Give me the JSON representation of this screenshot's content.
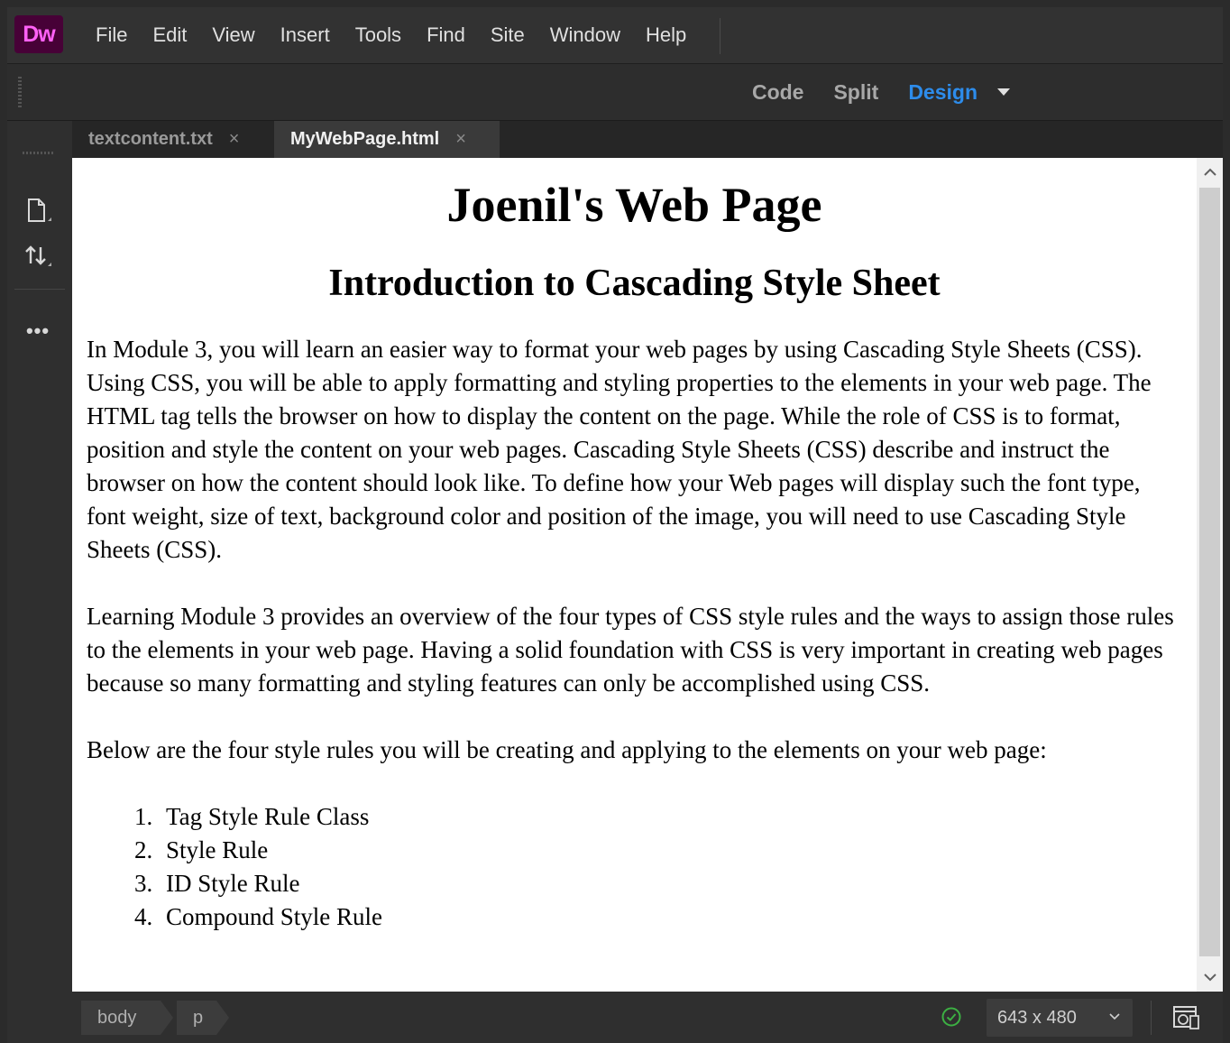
{
  "app": {
    "logo": "Dw"
  },
  "menu": {
    "items": [
      "File",
      "Edit",
      "View",
      "Insert",
      "Tools",
      "Find",
      "Site",
      "Window",
      "Help"
    ]
  },
  "view_modes": {
    "code": "Code",
    "split": "Split",
    "design": "Design",
    "active": "Design"
  },
  "tabs": [
    {
      "label": "textcontent.txt",
      "close": "×",
      "active": false
    },
    {
      "label": "MyWebPage.html",
      "close": "×",
      "active": true
    }
  ],
  "left_toolbar": {
    "icons": [
      "file-icon",
      "sort-arrows-icon",
      "more-icon"
    ],
    "more_label": "•••"
  },
  "document": {
    "heading1": "Joenil's Web Page",
    "heading2": "Introduction to Cascading Style Sheet",
    "paragraph1": "In Module 3, you will learn an easier way to format your web pages by using Cascading Style Sheets (CSS). Using CSS, you will be able to apply formatting and styling properties to the elements in your web page. The HTML tag tells the browser on how to display the content on the page. While the role of CSS is to format, position and style the content on your web pages. Cascading Style Sheets (CSS) describe and instruct the browser on how the content should look like. To define how your Web pages will display such the font type, font weight, size of text, background color and position of the image, you will need to use Cascading Style Sheets (CSS).",
    "paragraph2": "Learning Module 3 provides an overview of the four types of CSS style rules and the ways to assign those rules to the elements in your web page. Having a solid foundation with CSS is very important in creating web pages because so many formatting and styling features can only be accomplished using CSS.",
    "paragraph3": "Below are the four style rules you will be creating and applying to the elements on your web page:",
    "list": [
      "Tag Style Rule Class",
      "Style Rule",
      "ID Style Rule",
      "Compound Style Rule"
    ]
  },
  "status_bar": {
    "breadcrumbs": [
      "body",
      "p"
    ],
    "window_size": "643 x 480"
  },
  "colors": {
    "accent": "#2d8ceb",
    "logo_bg": "#470137",
    "logo_text": "#ff61f6",
    "ok_green": "#3cb043"
  }
}
